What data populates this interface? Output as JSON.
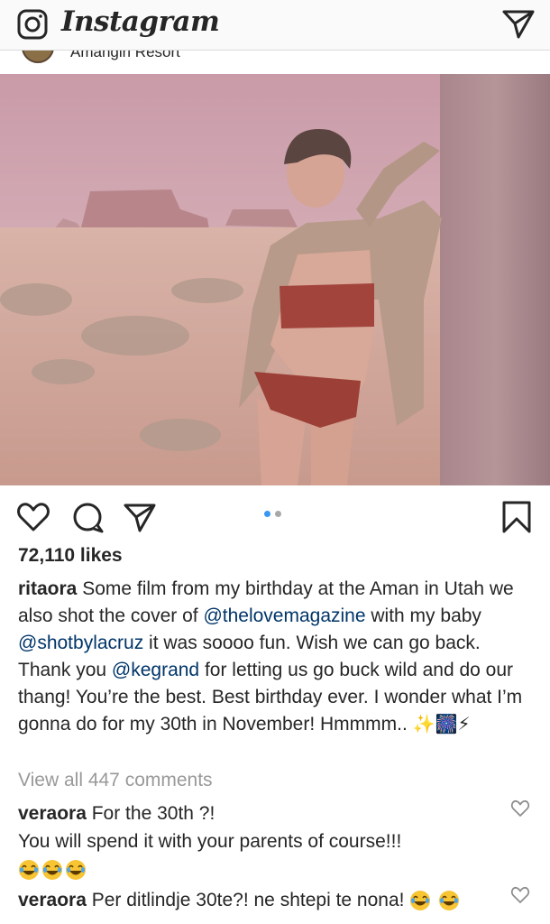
{
  "header": {
    "brand": "Instagram",
    "camera_icon": "camera-icon",
    "dm_icon": "direct-message-icon"
  },
  "post": {
    "location": "Amangiri Resort",
    "likes": "72,110 likes",
    "carousel": {
      "count": 2,
      "active": 1,
      "active_color": "#3897f0",
      "inactive_color": "#a8a8a8"
    },
    "caption": {
      "user": "ritaora",
      "t1": " Some film from my birthday at the Aman in Utah we also shot the cover of ",
      "m1": "@thelovemagazine",
      "t2": " with my baby ",
      "m2": "@shotbylacruz",
      "t3": " it was soooo fun. Wish we can go back. Thank you ",
      "m3": "@kegrand",
      "t4": " for letting us go buck wild and do our thang! You’re the best. Best birthday ever. I wonder what I’m gonna do for my 30th in November! Hmmmm.. ",
      "emojis": "✨🎆⚡"
    },
    "view_all": "View all 447 comments",
    "comments": [
      {
        "user": "veraora",
        "text": " For the 30th ?!",
        "line2": "You will spend it with your parents of course!!!",
        "emoji_count": 3
      },
      {
        "user": "veraora",
        "text": " Per ditlindje 30te?! ne shtepi te nona! ",
        "emoji_count": 2
      }
    ]
  },
  "colors": {
    "text": "#262626",
    "muted": "#999999",
    "mention": "#003569",
    "accent": "#3897f0"
  }
}
